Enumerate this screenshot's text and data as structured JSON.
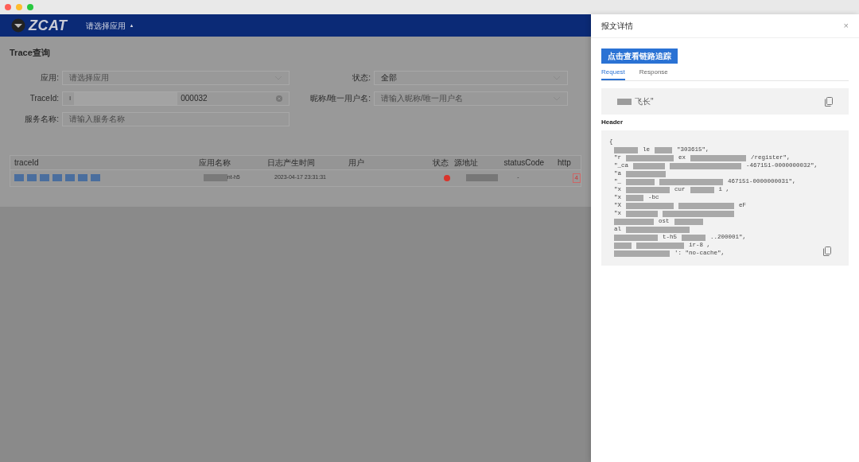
{
  "window": {
    "controls": [
      {
        "color": "#ff5f57"
      },
      {
        "color": "#febc2e"
      },
      {
        "color": "#28c840"
      }
    ]
  },
  "header": {
    "logo": "ZCAT",
    "app_menu": "请选择应用",
    "menu_caret": "▲"
  },
  "page": {
    "title": "Trace查询",
    "filters": [
      {
        "label": "应用:",
        "placeholder": "请选择应用",
        "kind": "select"
      },
      {
        "label": "状态:",
        "value": "全部",
        "kind": "select"
      },
      {
        "label": "TraceId:",
        "value": "000032",
        "prefix": "I",
        "kind": "clearable"
      },
      {
        "label": "昵称/唯一用户名:",
        "placeholder": "请输入昵称/唯一用户名",
        "kind": "select"
      },
      {
        "label": "服务名称:",
        "placeholder": "请输入服务名称",
        "kind": "text"
      }
    ],
    "table": {
      "columns": [
        "traceId",
        "应用名称",
        "日志产生时间",
        "用户",
        "状态",
        "源地址",
        "statusCode",
        "http"
      ],
      "rows": [
        {
          "app": "nt-h5",
          "time": "2023-04-17 23:31:31",
          "color": "#d9342b",
          "status_code": "-",
          "http": "4"
        }
      ]
    }
  },
  "drawer": {
    "title": "报文详情",
    "close": "×",
    "trace_button": "点击查看链路追踪",
    "tabs": [
      {
        "label": "Request",
        "selected": true
      },
      {
        "label": "Response",
        "selected": false
      }
    ],
    "body_text": "飞长\"",
    "header_label": "Header",
    "code_lines": [
      [
        {
          "kind": "text",
          "text": "{"
        }
      ],
      [
        {
          "kind": "mask"
        },
        {
          "kind": "text",
          "text": "le"
        },
        {
          "kind": "mask"
        },
        {
          "kind": "text",
          "text": "\"303615\","
        }
      ],
      [
        {
          "kind": "text",
          "text": "\"r"
        },
        {
          "kind": "mask"
        },
        {
          "kind": "text",
          "text": "ex"
        },
        {
          "kind": "mask"
        },
        {
          "kind": "text",
          "text": "/register\","
        }
      ],
      [
        {
          "kind": "text",
          "text": "\"_ca"
        },
        {
          "kind": "mask"
        },
        {
          "kind": "mask"
        },
        {
          "kind": "text",
          "text": "-467151-0000000032\","
        }
      ],
      [
        {
          "kind": "text",
          "text": "\"a"
        },
        {
          "kind": "mask"
        }
      ],
      [
        {
          "kind": "text",
          "text": "\"_"
        },
        {
          "kind": "mask"
        },
        {
          "kind": "mask"
        },
        {
          "kind": "text",
          "text": "467151-0000000031\","
        }
      ],
      [
        {
          "kind": "text",
          "text": "\"x"
        },
        {
          "kind": "mask"
        },
        {
          "kind": "text",
          "text": "cur"
        },
        {
          "kind": "mask"
        },
        {
          "kind": "text",
          "text": "i ,"
        }
      ],
      [
        {
          "kind": "text",
          "text": "\"x"
        },
        {
          "kind": "mask"
        },
        {
          "kind": "text",
          "text": "-bc"
        }
      ],
      [
        {
          "kind": "text",
          "text": "\"X"
        },
        {
          "kind": "mask"
        },
        {
          "kind": "mask"
        },
        {
          "kind": "text",
          "text": "eF"
        }
      ],
      [
        {
          "kind": "text",
          "text": "\"x"
        },
        {
          "kind": "mask"
        },
        {
          "kind": "mask"
        }
      ],
      [
        {
          "kind": "mask"
        },
        {
          "kind": "text",
          "text": "ost"
        },
        {
          "kind": "mask"
        }
      ],
      [
        {
          "kind": "text",
          "text": "al"
        },
        {
          "kind": "mask"
        }
      ],
      [
        {
          "kind": "mask"
        },
        {
          "kind": "text",
          "text": "t-h5"
        },
        {
          "kind": "mask"
        },
        {
          "kind": "text",
          "text": "..200001\","
        }
      ],
      [
        {
          "kind": "mask"
        },
        {
          "kind": "mask"
        },
        {
          "kind": "text",
          "text": "ir-8 ,"
        }
      ],
      [
        {
          "kind": "mask"
        },
        {
          "kind": "text",
          "text": "': \"no-cache\","
        }
      ]
    ]
  }
}
